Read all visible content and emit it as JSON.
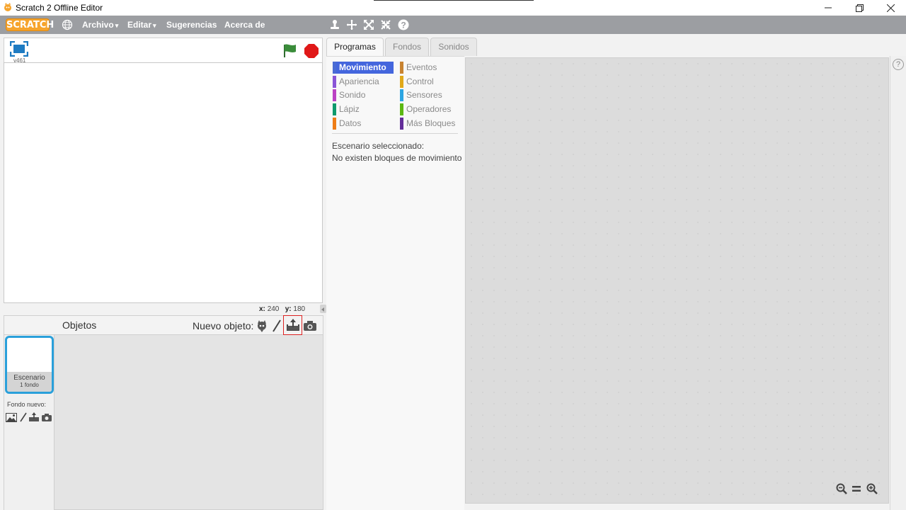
{
  "window": {
    "title": "Scratch 2 Offline Editor",
    "controls": [
      "minimize-icon",
      "restore-icon",
      "close-icon"
    ]
  },
  "menubar": {
    "logo": "SCRATCH",
    "items": [
      {
        "label": "Archivo",
        "caret": "▾"
      },
      {
        "label": "Editar",
        "caret": "▾"
      },
      {
        "label": "Sugerencias"
      },
      {
        "label": "Acerca de"
      }
    ],
    "tools": [
      "stamp-icon",
      "cut-icon",
      "grow-icon",
      "shrink-icon",
      "help-icon"
    ]
  },
  "stage": {
    "version": "v461",
    "coords": {
      "x_label": "x:",
      "x": "240",
      "y_label": "y:",
      "y": "180"
    }
  },
  "sprites": {
    "objetos_label": "Objetos",
    "nuevo_objeto_label": "Nuevo objeto:",
    "stage_thumb": {
      "name": "Escenario",
      "count": "1 fondo"
    },
    "fondo_nuevo_label": "Fondo nuevo:"
  },
  "tabs": [
    {
      "label": "Programas",
      "active": true
    },
    {
      "label": "Fondos",
      "active": false
    },
    {
      "label": "Sonidos",
      "active": false
    }
  ],
  "categories": [
    {
      "label": "Movimiento",
      "color": "#4a6cd4",
      "active": true
    },
    {
      "label": "Eventos",
      "color": "#c88330"
    },
    {
      "label": "Apariencia",
      "color": "#8a55d7"
    },
    {
      "label": "Control",
      "color": "#e1a91a"
    },
    {
      "label": "Sonido",
      "color": "#bb42c3"
    },
    {
      "label": "Sensores",
      "color": "#2ca5e2"
    },
    {
      "label": "Lápiz",
      "color": "#0e9a6c"
    },
    {
      "label": "Operadores",
      "color": "#5cb712"
    },
    {
      "label": "Datos",
      "color": "#ee7d16"
    },
    {
      "label": "Más Bloques",
      "color": "#632d99"
    }
  ],
  "palette_info": {
    "line1": "Escenario seleccionado:",
    "line2": "No existen bloques de movimiento"
  },
  "colors": {
    "menubar": "#9c9ea2",
    "accent_blue": "#2aa0da",
    "flag_green": "#2f7a2f",
    "stop_red": "#e01818"
  }
}
